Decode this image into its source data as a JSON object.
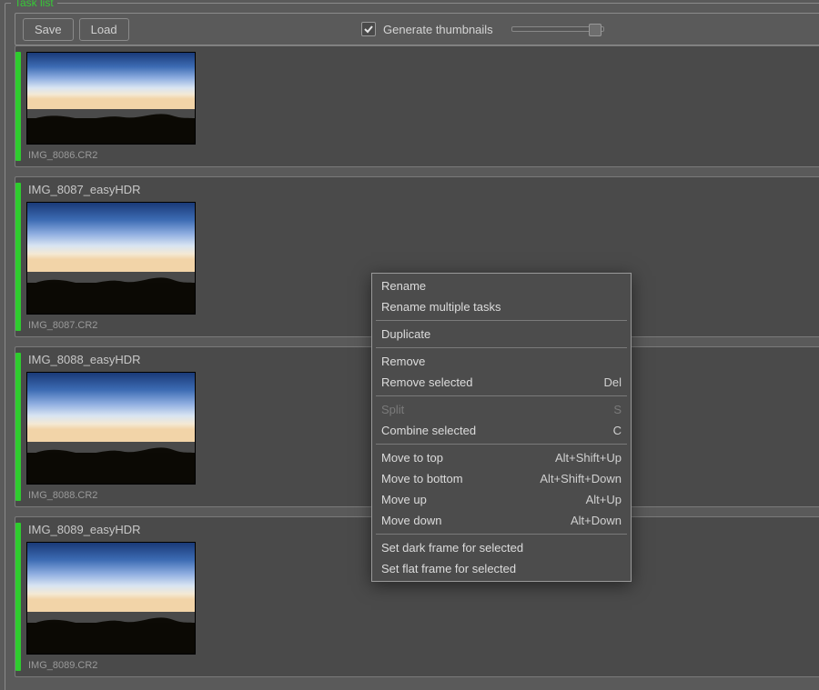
{
  "panel": {
    "title": "Task list"
  },
  "toolbar": {
    "save_label": "Save",
    "load_label": "Load",
    "gen_thumbs_label": "Generate thumbnails",
    "gen_thumbs_checked": true
  },
  "tasks": [
    {
      "title": "",
      "image": "IMG_8086.CR2"
    },
    {
      "title": "IMG_8087_easyHDR",
      "image": "IMG_8087.CR2"
    },
    {
      "title": "IMG_8088_easyHDR",
      "image": "IMG_8088.CR2"
    },
    {
      "title": "IMG_8089_easyHDR",
      "image": "IMG_8089.CR2"
    }
  ],
  "context_menu": {
    "rename": "Rename",
    "rename_multi": "Rename multiple tasks",
    "duplicate": "Duplicate",
    "remove": "Remove",
    "remove_selected": "Remove selected",
    "remove_selected_sc": "Del",
    "split": "Split",
    "split_sc": "S",
    "combine_selected": "Combine selected",
    "combine_selected_sc": "C",
    "move_top": "Move to top",
    "move_top_sc": "Alt+Shift+Up",
    "move_bottom": "Move to bottom",
    "move_bottom_sc": "Alt+Shift+Down",
    "move_up": "Move up",
    "move_up_sc": "Alt+Up",
    "move_down": "Move down",
    "move_down_sc": "Alt+Down",
    "set_dark": "Set dark frame for selected",
    "set_flat": "Set flat frame for selected"
  }
}
